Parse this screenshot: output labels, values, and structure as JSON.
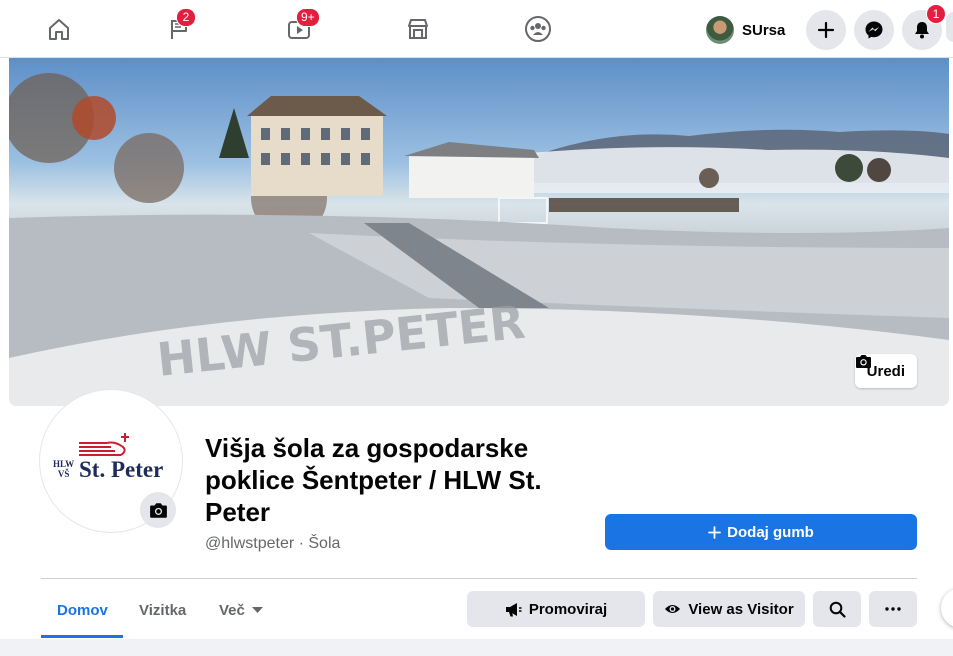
{
  "nav": {
    "tabs": [
      {
        "name": "home-icon",
        "badge": ""
      },
      {
        "name": "flag-icon",
        "badge": "2"
      },
      {
        "name": "watch-icon",
        "badge": "9+"
      },
      {
        "name": "marketplace-icon",
        "badge": ""
      },
      {
        "name": "groups-icon",
        "badge": ""
      }
    ],
    "profile_name": "SUrsa",
    "notifications_badge": "1"
  },
  "cover": {
    "edit_label": "Uredi",
    "snow_writing": "HLW ST.PETER"
  },
  "logo": {
    "small_top": "HLW",
    "small_bottom": "VŠ",
    "main": "St. Peter"
  },
  "page": {
    "title": "Višja šola za gospodarske poklice Šentpeter / HLW St. Peter",
    "subtitle": "@hlwstpeter · Šola",
    "add_button_label": "Dodaj gumb"
  },
  "tabs": {
    "home": "Domov",
    "about": "Vizitka",
    "more": "Več"
  },
  "actions": {
    "promote": "Promoviraj",
    "view_as_visitor": "View as Visitor"
  },
  "colors": {
    "accent": "#1b74e4",
    "badge": "#e41e3f",
    "logo_navy": "#1f2b5c",
    "logo_red": "#c8202f"
  }
}
